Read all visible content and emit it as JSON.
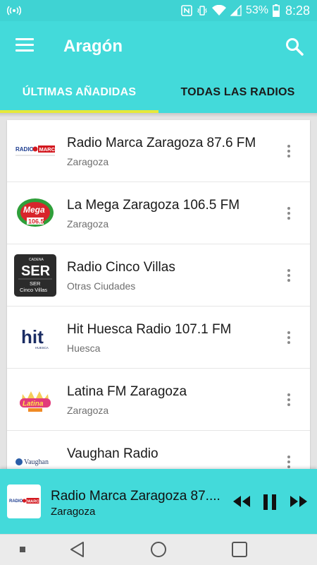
{
  "status_bar": {
    "battery_percent": "53%",
    "time": "8:28",
    "icons": [
      "radio-signal-icon",
      "nfc-icon",
      "vibrate-icon",
      "wifi-icon",
      "cell-signal-icon",
      "battery-icon"
    ]
  },
  "app_bar": {
    "title": "Aragón",
    "icons": [
      "menu-icon",
      "search-icon"
    ]
  },
  "tabs": [
    {
      "label": "ÚLTIMAS AÑADIDAS",
      "active": true
    },
    {
      "label": "TODAS LAS RADIOS",
      "active": false
    }
  ],
  "stations": [
    {
      "name": "Radio Marca Zaragoza 87.6 FM",
      "city": "Zaragoza",
      "logo": "RADIO MARCA",
      "logo_icon": "radio-marca-logo"
    },
    {
      "name": "La Mega Zaragoza 106.5 FM",
      "city": "Zaragoza",
      "logo": "La Mega 106.5",
      "logo_icon": "la-mega-logo"
    },
    {
      "name": "Radio Cinco Villas",
      "city": "Otras Ciudades",
      "logo": "SER Cinco Villas",
      "logo_icon": "ser-logo"
    },
    {
      "name": "Hit Huesca Radio 107.1 FM",
      "city": "Huesca",
      "logo": "hit",
      "logo_icon": "hit-logo"
    },
    {
      "name": "Latina FM Zaragoza",
      "city": "Zaragoza",
      "logo": "Latina",
      "logo_icon": "latina-logo"
    },
    {
      "name": "Vaughan Radio",
      "city": "",
      "logo": "Vaughan",
      "logo_icon": "vaughan-logo"
    }
  ],
  "player": {
    "title": "Radio Marca Zaragoza 87....",
    "city": "Zaragoza",
    "icons": [
      "rewind-icon",
      "pause-icon",
      "fast-forward-icon"
    ]
  },
  "navbar": {
    "icons": [
      "recent-dot-icon",
      "back-icon",
      "home-icon",
      "overview-icon"
    ]
  },
  "colors": {
    "accent": "#43dada",
    "status_bar": "#3fd3d3",
    "tab_indicator": "#e6e83a",
    "background": "#e4e4e4"
  }
}
